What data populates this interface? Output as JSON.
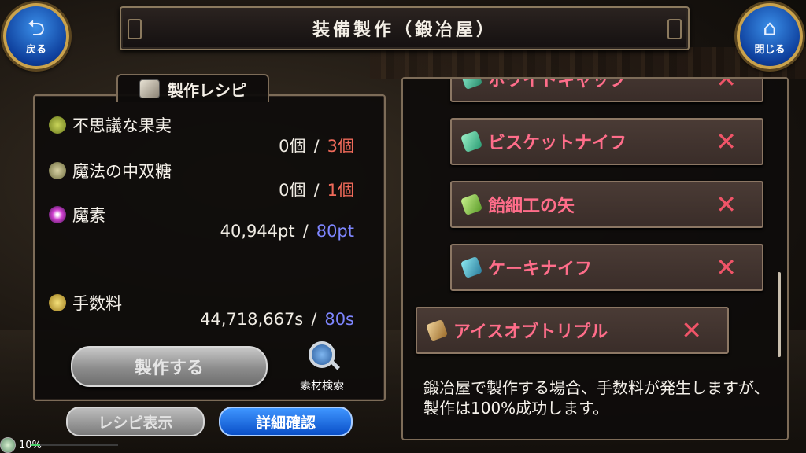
{
  "header": {
    "title": "装備製作（鍛冶屋）",
    "back_label": "戻る",
    "close_label": "閉じる"
  },
  "recipe_panel": {
    "heading": "製作レシピ",
    "materials": [
      {
        "name": "不思議な果実",
        "have": "0個",
        "need": "3個"
      },
      {
        "name": "魔法の中双糖",
        "have": "0個",
        "need": "1個"
      },
      {
        "name": "魔素",
        "have": "40,944pt",
        "need": "80pt"
      }
    ],
    "fee": {
      "name": "手数料",
      "have": "44,718,667s",
      "need": "80s"
    },
    "slash": "/",
    "craft_button": "製作する",
    "search_label": "素材検索"
  },
  "bottom_tabs": {
    "recipe_view": "レシピ表示",
    "detail_check": "詳細確認"
  },
  "exp": {
    "label": "10%",
    "progress": 0.1
  },
  "item_list": [
    {
      "name": "ホワイトキャップ"
    },
    {
      "name": "ビスケットナイフ"
    },
    {
      "name": "飴細工の矢"
    },
    {
      "name": "ケーキナイフ"
    },
    {
      "name": "アイスオブトリプル"
    }
  ],
  "item_remove_mark": "✕",
  "message": "鍛冶屋で製作する場合、手数料が発生しますが、製作は100%成功します。",
  "colors": {
    "required_red": "#f06a5a",
    "required_blue": "#7e86ff",
    "item_text": "#ff6d8a",
    "accent_blue": "#0a4fc8"
  },
  "icons": {
    "back": "back-arrow-icon",
    "close": "home-icon",
    "heading": "recipe-scroll-icon",
    "search": "magnifier-icon"
  }
}
